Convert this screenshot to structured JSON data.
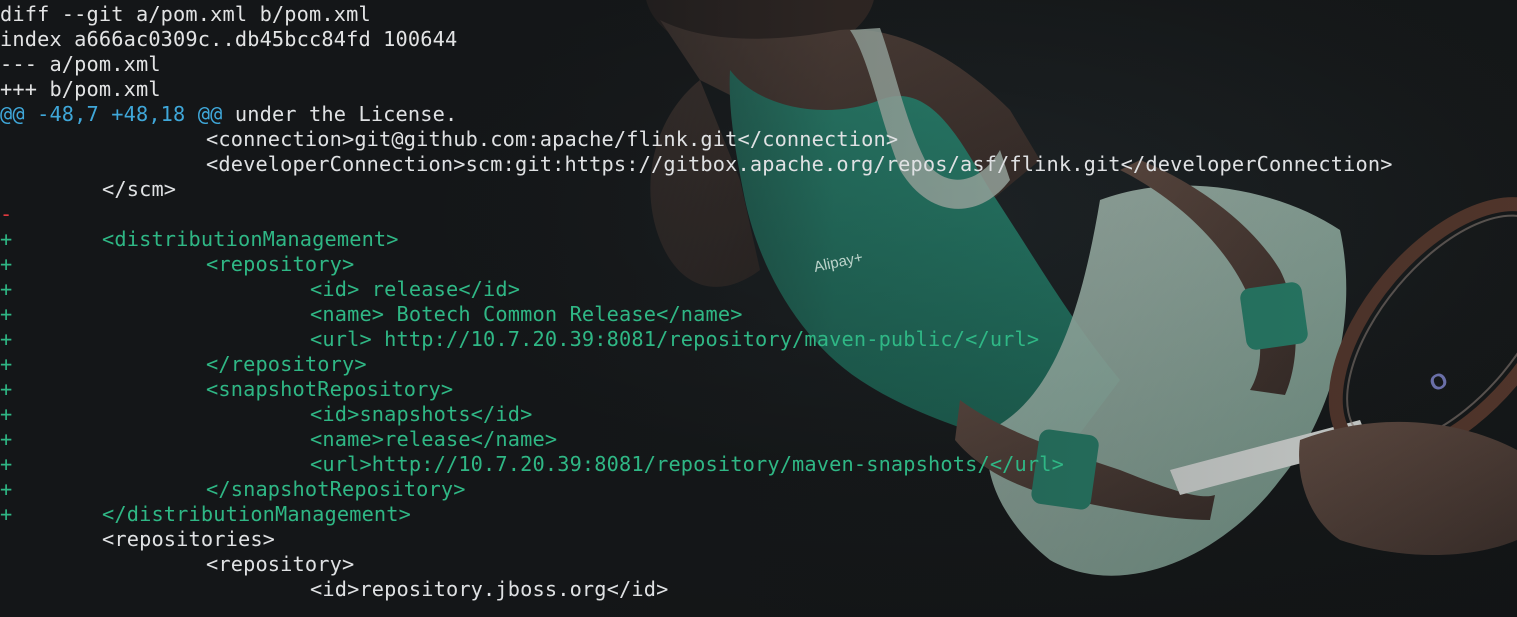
{
  "diff": {
    "header_lines": [
      "diff --git a/pom.xml b/pom.xml",
      "index a666ac0309c..db45bcc84fd 100644",
      "--- a/pom.xml",
      "+++ b/pom.xml"
    ],
    "hunk": {
      "marker": "@@ -48,7 +48,18 @@",
      "context": " under the License."
    },
    "lines": [
      {
        "prefix": "",
        "indent": 2,
        "text": "<connection>git@github.com:apache/flink.git</connection>",
        "kind": "context"
      },
      {
        "prefix": "",
        "indent": 2,
        "text": "<developerConnection>scm:git:https://gitbox.apache.org/repos/asf/flink.git</developerConnection>",
        "kind": "context"
      },
      {
        "prefix": "",
        "indent": 1,
        "text": "</scm>",
        "kind": "context"
      },
      {
        "prefix": "-",
        "indent": 0,
        "text": "",
        "kind": "removed"
      },
      {
        "prefix": "+",
        "indent": 1,
        "text": "<distributionManagement>",
        "kind": "added"
      },
      {
        "prefix": "+",
        "indent": 2,
        "text": "<repository>",
        "kind": "added"
      },
      {
        "prefix": "+",
        "indent": 3,
        "text": "<id> release</id>",
        "kind": "added"
      },
      {
        "prefix": "+",
        "indent": 3,
        "text": "<name> Botech Common Release</name>",
        "kind": "added"
      },
      {
        "prefix": "+",
        "indent": 3,
        "text": "<url> http://10.7.20.39:8081/repository/maven-public/</url>",
        "kind": "added"
      },
      {
        "prefix": "+",
        "indent": 2,
        "text": "</repository>",
        "kind": "added"
      },
      {
        "prefix": "+",
        "indent": 2,
        "text": "<snapshotRepository>",
        "kind": "added"
      },
      {
        "prefix": "+",
        "indent": 3,
        "text": "<id>snapshots</id>",
        "kind": "added"
      },
      {
        "prefix": "+",
        "indent": 3,
        "text": "<name>release</name>",
        "kind": "added"
      },
      {
        "prefix": "+",
        "indent": 3,
        "text": "<url>http://10.7.20.39:8081/repository/maven-snapshots/</url>",
        "kind": "added"
      },
      {
        "prefix": "+",
        "indent": 2,
        "text": "</snapshotRepository>",
        "kind": "added"
      },
      {
        "prefix": "+",
        "indent": 1,
        "text": "</distributionManagement>",
        "kind": "added"
      },
      {
        "prefix": "",
        "indent": 1,
        "text": "<repositories>",
        "kind": "context"
      },
      {
        "prefix": "",
        "indent": 2,
        "text": "<repository>",
        "kind": "context"
      },
      {
        "prefix": "",
        "indent": 3,
        "text": "<id>repository.jboss.org</id>",
        "kind": "context"
      }
    ]
  },
  "wallpaper": {
    "subject": "tennis-player-photo",
    "logo_text": "Alipay+",
    "racket_mark": "O"
  },
  "colors": {
    "background": "#141618",
    "added": "#2fb785",
    "removed": "#e0393e",
    "hunk": "#3fa7d9",
    "context": "#dfe1e3"
  }
}
